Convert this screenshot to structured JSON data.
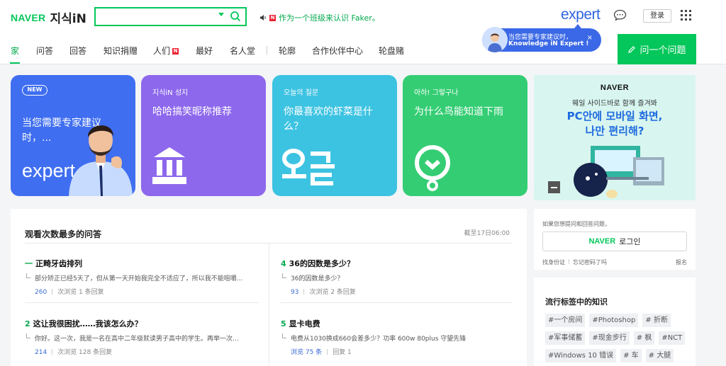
{
  "header": {
    "logo_naver": "NAVER",
    "logo_kin": "지식iN",
    "notice": "作为一个班级来认识 Faker。",
    "notice_badge": "N",
    "expert_logo": "expert",
    "login_label": "登录"
  },
  "nav": {
    "items": [
      "家",
      "问答",
      "回答",
      "知识捐赠",
      "人们",
      "最好",
      "名人堂",
      "轮廓",
      "合作伙伴中心",
      "轮盘赌"
    ],
    "people_badge": "N",
    "ask_button": "问一个问题"
  },
  "tooltip": {
    "line1": "当您需要专家建议时，",
    "line2": "Knowledge iN Expert !",
    "close": "×"
  },
  "cards": [
    {
      "tag": "NEW",
      "title": "当您需要专家建议时，...",
      "word": "expert"
    },
    {
      "tag": "지식iN 성지",
      "title": "哈哈搞笑昵称推荐"
    },
    {
      "tag": "오늘의 질문",
      "title": "你最喜欢的虾菜是什么？"
    },
    {
      "tag": "아하! 그렇구나",
      "title": "为什么鸟能知道下雨"
    }
  ],
  "ad": {
    "brand": "NAVER",
    "sub": "웨일 사이드바로 함께 즐겨봐",
    "big1": "PC안에 모바일 화면,",
    "big2": "나만 편리해?"
  },
  "main": {
    "title": "观看次数最多的问答",
    "time": "截至17日06:00",
    "questions": [
      {
        "rank": "一",
        "title": "正畸牙齿排列",
        "excerpt": "部分矫正已经5天了，但从第一天开始我完全不适应了，所以我不能咀嚼...",
        "count": "260",
        "meta": "次浏览 1 条回复"
      },
      {
        "rank": "2",
        "title": "这让我很困扰……我该怎么办？",
        "excerpt": "你好。这一次，我是一名在高中二年级就读男子高中的学生。再举一次。...",
        "count": "214",
        "meta": "次浏览 128 条回复"
      },
      {
        "rank": "4",
        "title": "36的因数是多少？",
        "excerpt": "36的因数是多少？",
        "count": "93",
        "meta": "次浏览 2 条回复"
      },
      {
        "rank": "5",
        "title": "显卡电费",
        "excerpt": "电费从1030换成660会差多少？功率 600w 80plus 守望先锋",
        "count": "浏览 75 条",
        "meta": "回复 1"
      }
    ]
  },
  "login_box": {
    "hint": "如果您想提问和回答问题，",
    "naver": "NAVER",
    "login": "로그인",
    "find_id": "找身份证",
    "find_pw": "忘记密码了吗",
    "register": "报名"
  },
  "tags": {
    "title": "流行标签中的知识",
    "items": [
      "#一个房间",
      "#Photoshop",
      "# 折断",
      "#军事储蓄",
      "#现金步行",
      "# 枫",
      "#NCT",
      "#Windows 10 错误",
      "# 车",
      "# 大腿"
    ]
  },
  "colors": {
    "brand_green": "#03c75a",
    "expert_blue": "#3a68e6",
    "card1": "#3f6ef0",
    "card2": "#8d68ec",
    "card3": "#3dc3e2",
    "card4": "#34cd73"
  }
}
